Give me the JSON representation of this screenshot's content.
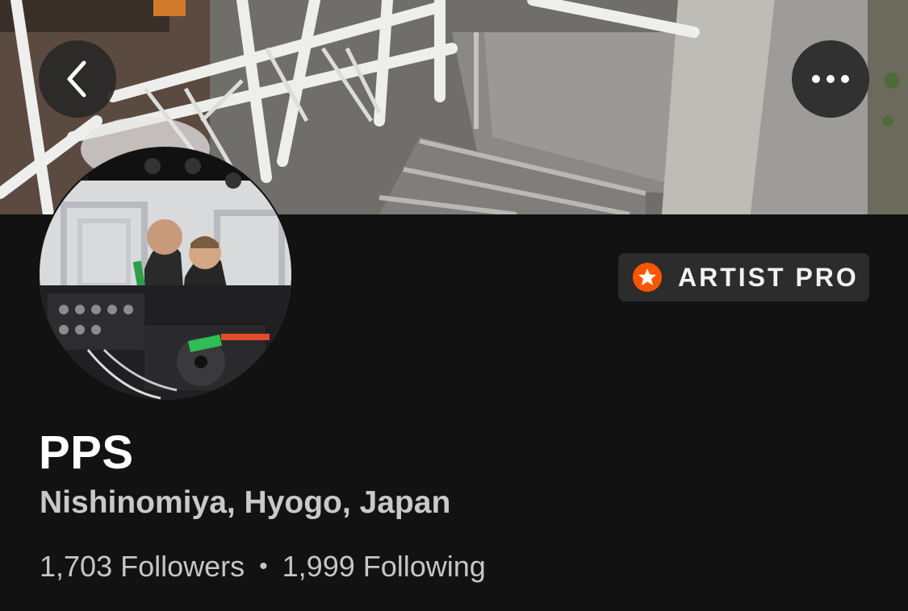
{
  "header": {
    "back_icon": "chevron-left-icon",
    "more_icon": "ellipsis-icon"
  },
  "badge": {
    "label": "ARTIST PRO",
    "icon": "star-badge-icon",
    "icon_color": "#ff5500"
  },
  "profile": {
    "name": "PPS",
    "location": "Nishinomiya, Hyogo, Japan",
    "followers_label": "1,703 Followers",
    "separator": "•",
    "following_label": "1,999 Following"
  },
  "colors": {
    "background": "#121212",
    "accent": "#ff5500"
  }
}
